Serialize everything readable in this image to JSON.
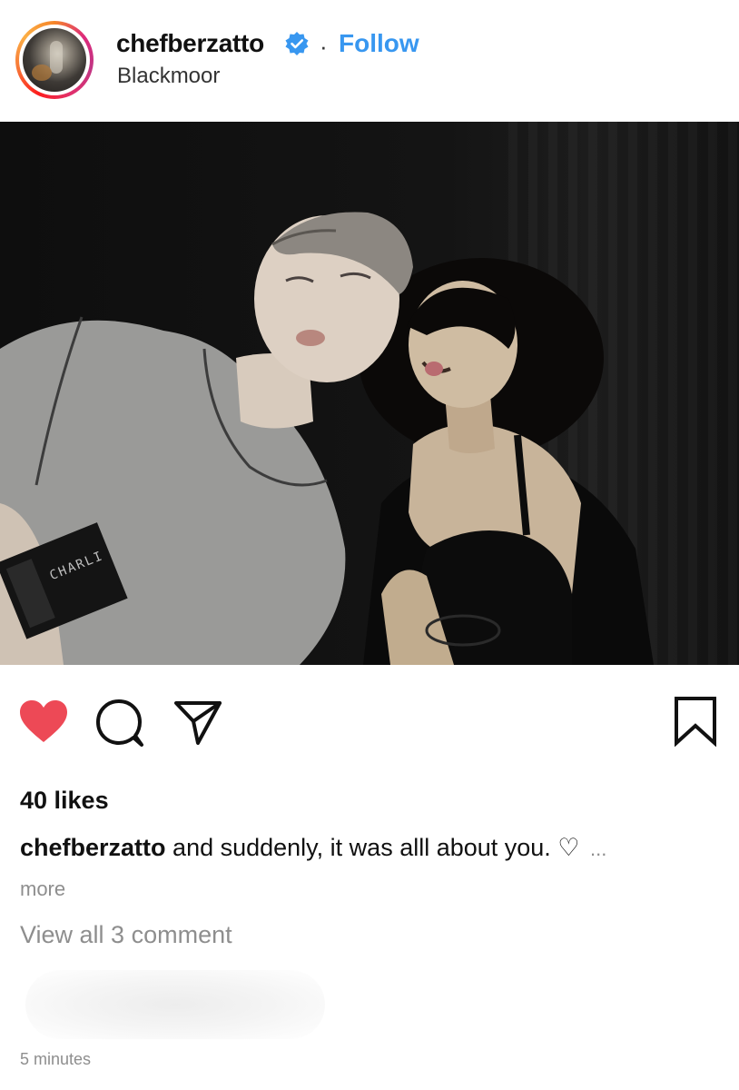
{
  "post": {
    "username": "chefberzatto",
    "follow_label": "Follow",
    "separator": "·",
    "location": "Blackmoor",
    "photo_text": "CHARLI",
    "likes": "40 likes",
    "caption_user": "chefberzatto",
    "caption_text": "and suddenly, it was alll about you. ♡",
    "caption_ellipsis": "...",
    "more_label": "more",
    "view_comments": "View all 3 comment",
    "timestamp": "5 minutes"
  },
  "icons": {
    "verified": "verified-badge-icon",
    "like": "heart-icon",
    "comment": "comment-bubble-icon",
    "share": "paper-plane-icon",
    "save": "bookmark-icon"
  },
  "colors": {
    "accent": "#3897f0",
    "like_red": "#ed4956",
    "muted_text": "#8e8e8e"
  }
}
